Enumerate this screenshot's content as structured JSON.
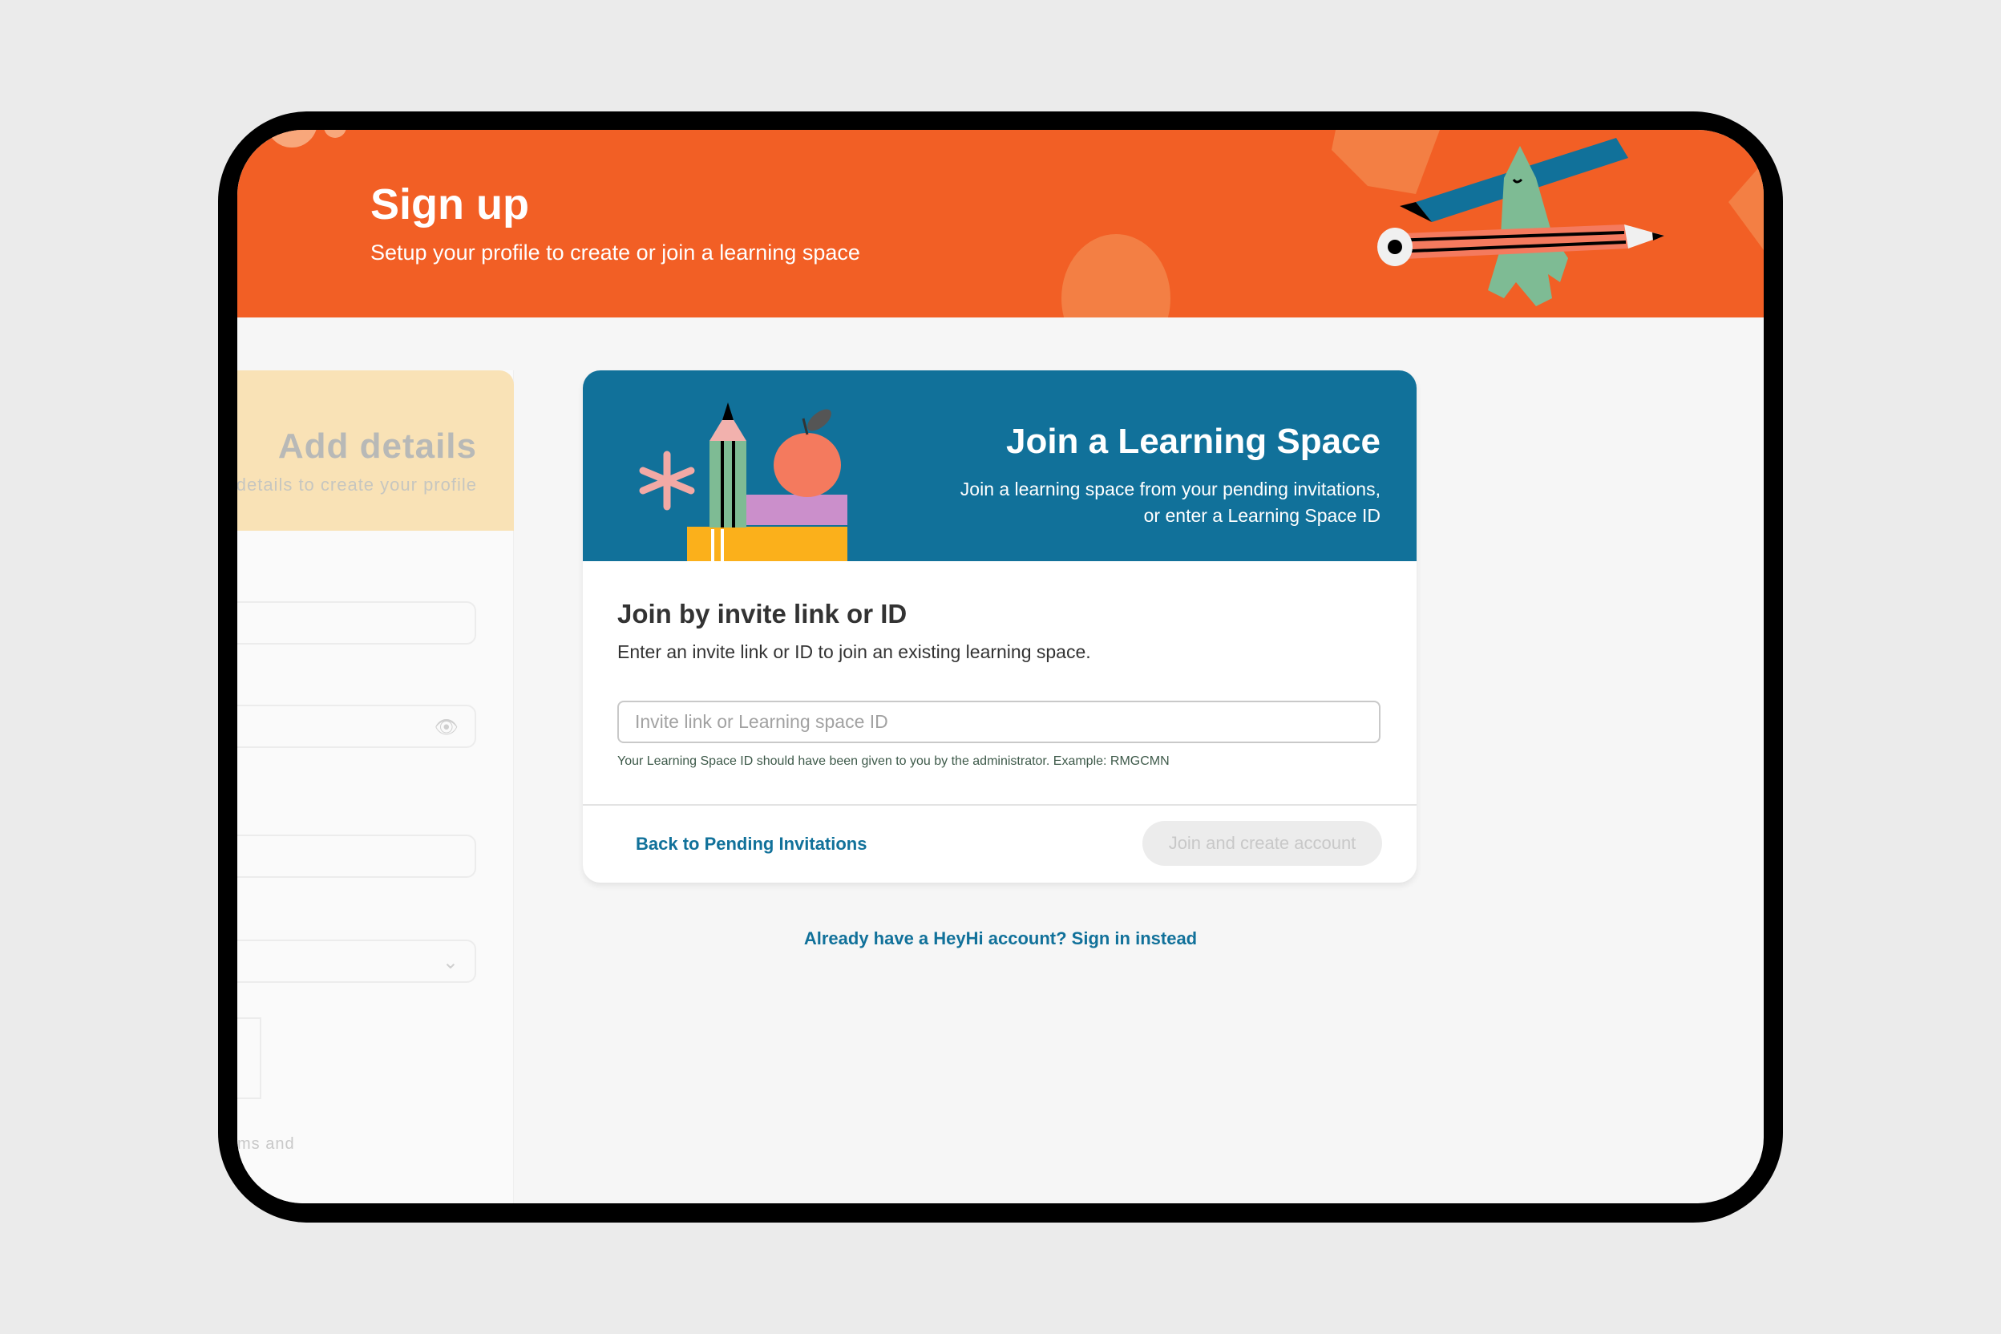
{
  "header": {
    "title": "Sign up",
    "subtitle": "Setup your profile to create or join a learning space"
  },
  "left_panel": {
    "title": "Add details",
    "subtitle": "details to create your profile",
    "terms_fragment": "ms and",
    "fields": [
      "text-field",
      "password-field",
      "text-field",
      "select-field"
    ]
  },
  "card": {
    "banner_title": "Join a Learning Space",
    "banner_subtitle_line1": "Join a learning space from your pending invitations,",
    "banner_subtitle_line2": "or enter a Learning Space ID",
    "heading": "Join by invite link or ID",
    "description": "Enter an invite link or ID to join an existing learning space.",
    "input": {
      "value": "",
      "placeholder": "Invite link or Learning space ID"
    },
    "hint": "Your Learning Space ID should have been given to you by the administrator. Example: RMGCMN",
    "back_label": "Back to Pending Invitations",
    "join_label": "Join and create account"
  },
  "signin_link": "Already have a HeyHi account? Sign in instead",
  "colors": {
    "header": "#f25f25",
    "brand_blue": "#11719a",
    "left_header": "#f9e2b6",
    "background": "#ebebeb"
  }
}
